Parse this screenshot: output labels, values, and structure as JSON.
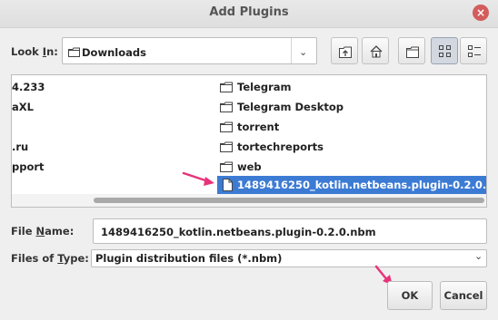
{
  "window": {
    "title": "Add Plugins",
    "close_glyph": "×"
  },
  "look_in": {
    "label_pre": "Look ",
    "label_key": "I",
    "label_post": "n:",
    "value": "Downloads",
    "arrow_glyph": "⌄"
  },
  "toolbar": {
    "icons": [
      "up-one-level-icon",
      "home-icon",
      "new-folder-icon",
      "list-view-icon",
      "details-view-icon"
    ],
    "active": "list-view-icon"
  },
  "files": {
    "left_column": [
      "4.233",
      "aXL",
      "",
      ".ru",
      "pport"
    ],
    "right_column": [
      "Telegram",
      "Telegram Desktop",
      "torrent",
      "tortechreports",
      "web"
    ],
    "selected": "1489416250_kotlin.netbeans.plugin-0.2.0.n..."
  },
  "file_name": {
    "label_pre": "File ",
    "label_key": "N",
    "label_post": "ame:",
    "value": "1489416250_kotlin.netbeans.plugin-0.2.0.nbm"
  },
  "file_type": {
    "label_pre": "Files of ",
    "label_key": "T",
    "label_post": "ype:",
    "value": "Plugin distribution files (*.nbm)",
    "arrow_glyph": "⌄"
  },
  "buttons": {
    "ok": "OK",
    "cancel": "Cancel"
  },
  "colors": {
    "selection": "#3c7bd4",
    "annotation_arrow": "#e8337a",
    "close": "#d35c5c"
  }
}
